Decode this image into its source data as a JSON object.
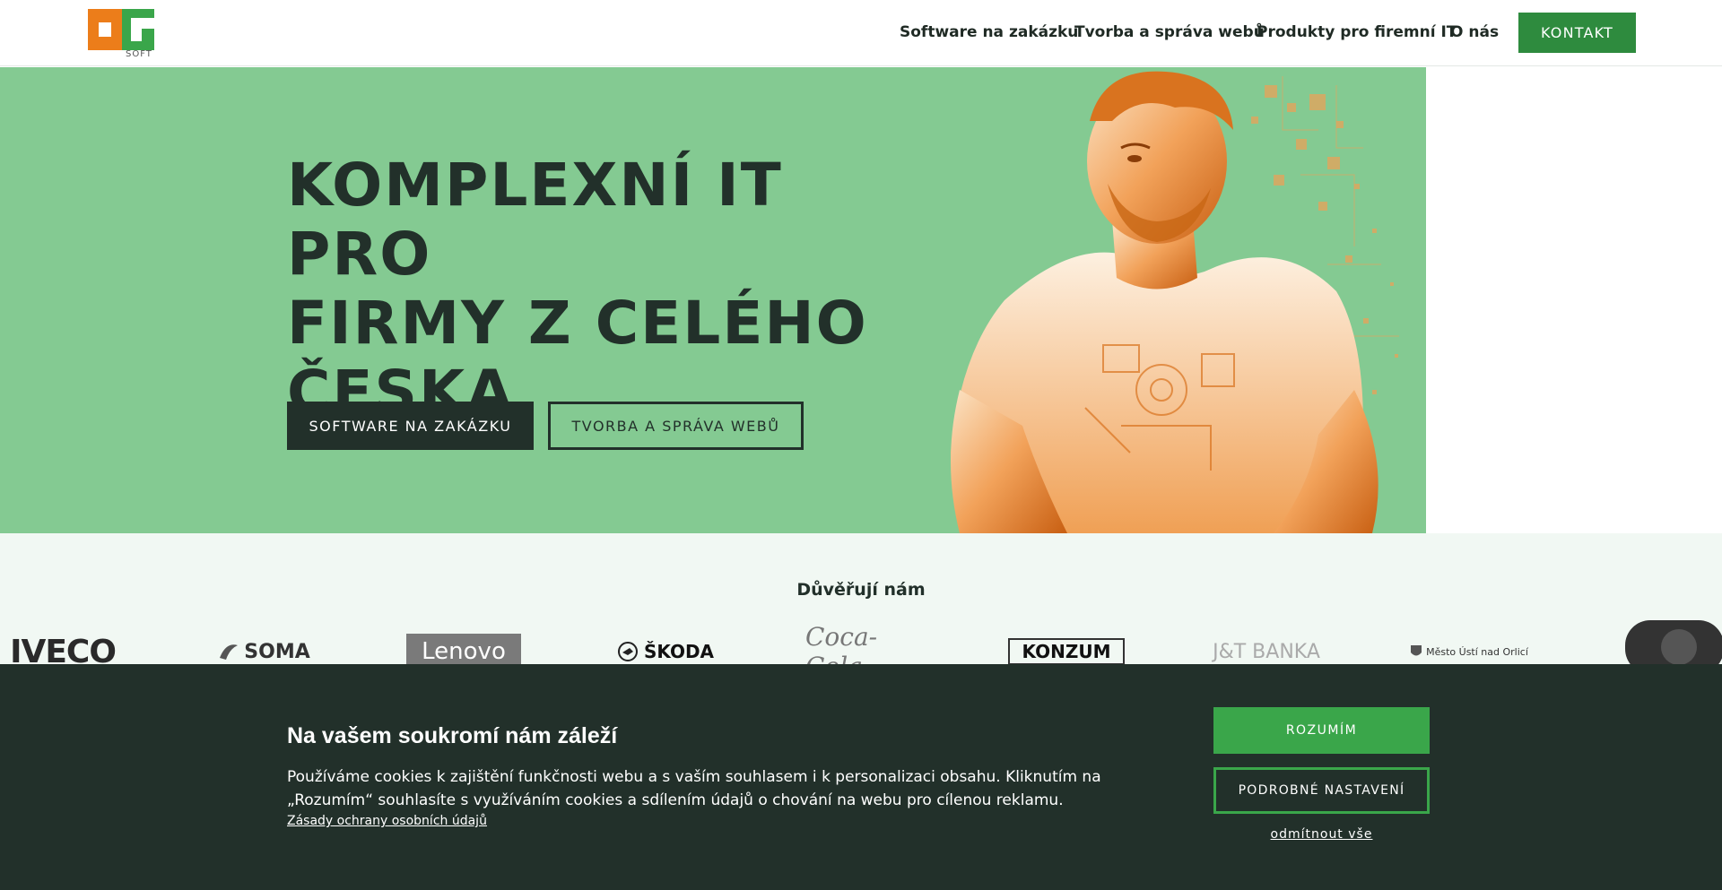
{
  "header": {
    "logo_text": "SOFT",
    "nav": [
      {
        "label": "Software na zakázku"
      },
      {
        "label": "Tvorba a správa webů"
      },
      {
        "label": "Produkty pro firemní IT"
      },
      {
        "label": "O nás"
      }
    ],
    "contact_label": "KONTAKT"
  },
  "hero": {
    "title_lines": [
      "KOMPLEXNÍ IT PRO",
      "FIRMY Z CELÉHO",
      "ČESKA"
    ],
    "primary_button": "SOFTWARE NA ZAKÁZKU",
    "secondary_button": "TVORBA A SPRÁVA WEBŮ"
  },
  "trust": {
    "title": "Důvěřují nám",
    "brands": [
      "IVECO",
      "SOMA",
      "Lenovo",
      "ŠKODA",
      "Coca-Cola",
      "KONZUM",
      "J&T BANKA",
      "Město Ústí nad Orlicí"
    ]
  },
  "cookie": {
    "title": "Na vašem soukromí nám záleží",
    "text": "Používáme cookies k zajištění funkčnosti webu a s vaším souhlasem i k personalizaci obsahu. Kliknutím na „Rozumím“ souhlasíte s využíváním cookies a sdílením údajů o chování na webu pro cílenou reklamu.",
    "policy_link": "Zásady ochrany osobních údajů",
    "accept": "ROZUMÍM",
    "settings": "PODROBNÉ NASTAVENÍ",
    "reject": "odmítnout vše"
  },
  "colors": {
    "brand_green": "#3aa64a",
    "brand_orange": "#ec7d1a",
    "hero_bg": "#84ca92",
    "dark": "#22302a"
  }
}
